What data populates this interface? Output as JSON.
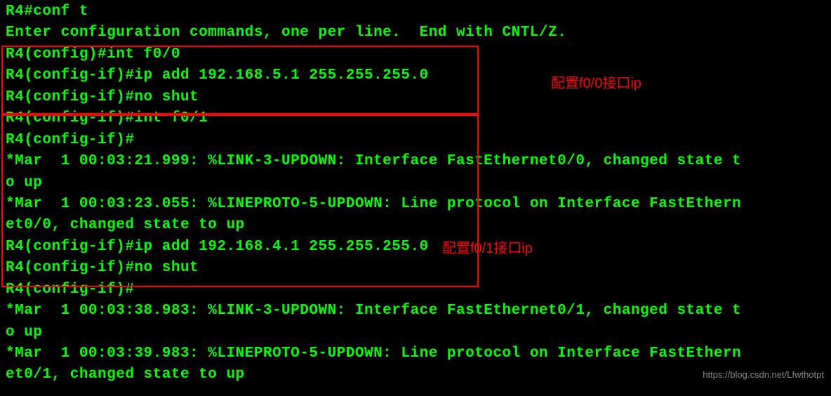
{
  "terminal": {
    "lines": [
      "R4#conf t",
      "Enter configuration commands, one per line.  End with CNTL/Z.",
      "R4(config)#int f0/0",
      "R4(config-if)#ip add 192.168.5.1 255.255.255.0",
      "R4(config-if)#no shut",
      "R4(config-if)#int f0/1",
      "R4(config-if)#",
      "*Mar  1 00:03:21.999: %LINK-3-UPDOWN: Interface FastEthernet0/0, changed state t",
      "o up",
      "*Mar  1 00:03:23.055: %LINEPROTO-5-UPDOWN: Line protocol on Interface FastEthern",
      "et0/0, changed state to up",
      "R4(config-if)#ip add 192.168.4.1 255.255.255.0",
      "R4(config-if)#no shut",
      "R4(config-if)#",
      "*Mar  1 00:03:38.983: %LINK-3-UPDOWN: Interface FastEthernet0/1, changed state t",
      "o up",
      "*Mar  1 00:03:39.983: %LINEPROTO-5-UPDOWN: Line protocol on Interface FastEthern",
      "et0/1, changed state to up"
    ]
  },
  "annotations": {
    "label1": "配置f0/0接口ip",
    "label2": "配置f0/1接口ip"
  },
  "watermark": "https://blog.csdn.net/Lfwthotpt"
}
